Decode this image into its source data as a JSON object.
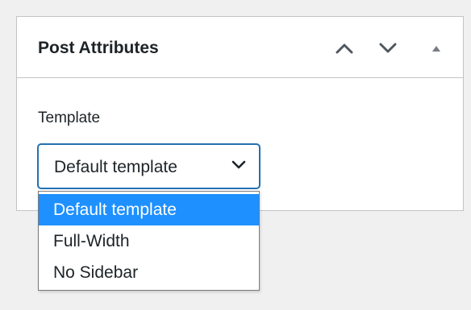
{
  "panel": {
    "title": "Post Attributes",
    "controls": {
      "move_up_icon": "chevron-up-icon",
      "move_down_icon": "chevron-down-icon",
      "toggle_icon": "triangle-up-icon"
    }
  },
  "template_field": {
    "label": "Template",
    "selected_value": "Default template",
    "chevron_icon": "chevron-down-icon",
    "options": [
      {
        "label": "Default template",
        "highlighted": true
      },
      {
        "label": "Full-Width",
        "highlighted": false
      },
      {
        "label": "No Sidebar",
        "highlighted": false
      }
    ]
  },
  "colors": {
    "background": "#f0f0f1",
    "panel": "#ffffff",
    "border": "#c3c4c7",
    "focus_border": "#2271b1",
    "highlight": "#1e90ff",
    "text": "#1d2327"
  }
}
